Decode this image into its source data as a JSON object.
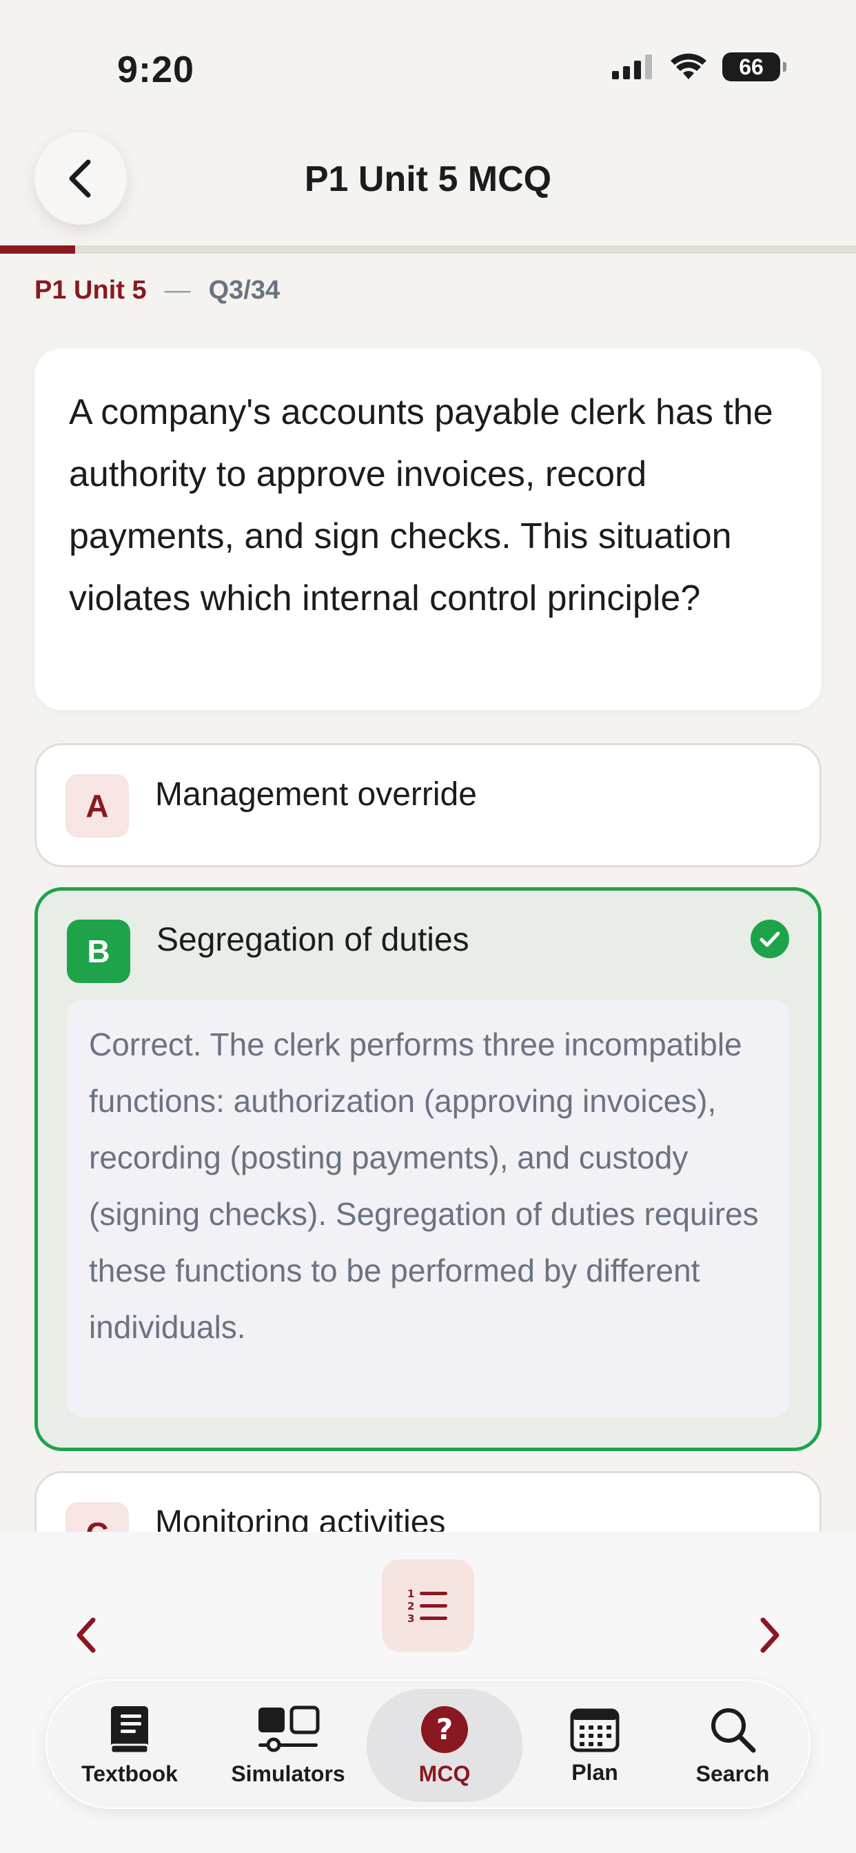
{
  "status": {
    "time": "9:20",
    "battery": "66"
  },
  "header": {
    "title": "P1 Unit 5 MCQ"
  },
  "progress": {
    "fraction": 0.088
  },
  "breadcrumb": {
    "unit": "P1 Unit 5",
    "separator": "—",
    "question": "Q3/34"
  },
  "question": {
    "text": "A company's accounts payable clerk has the authority to approve invoices, record payments, and sign checks. This situation violates which internal control principle?"
  },
  "options": [
    {
      "letter": "A",
      "label": "Management override"
    },
    {
      "letter": "B",
      "label": "Segregation of duties",
      "correct": true,
      "explanation": "Correct. The clerk performs three incompatible functions: authorization (approving invoices), recording (posting payments), and custody (signing checks). Segregation of duties requires these functions to be performed by different individuals."
    },
    {
      "letter": "C",
      "label": "Monitoring activities"
    }
  ],
  "tabs": [
    {
      "label": "Textbook",
      "icon": "book-icon"
    },
    {
      "label": "Simulators",
      "icon": "simulators-icon"
    },
    {
      "label": "MCQ",
      "icon": "question-icon",
      "active": true
    },
    {
      "label": "Plan",
      "icon": "calendar-icon"
    },
    {
      "label": "Search",
      "icon": "search-icon"
    }
  ],
  "colors": {
    "accent": "#8a1820",
    "correct": "#1fa34a",
    "background": "#f5f3f0"
  }
}
